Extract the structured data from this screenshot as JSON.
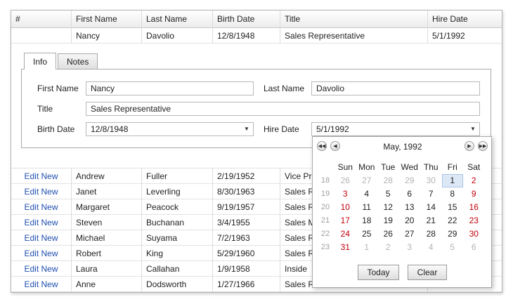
{
  "grid": {
    "columns": [
      "#",
      "First Name",
      "Last Name",
      "Birth Date",
      "Title",
      "Hire Date"
    ],
    "expanded_row": {
      "first": "Nancy",
      "last": "Davolio",
      "birth": "12/8/1948",
      "title": "Sales Representative",
      "hire": "5/1/1992"
    },
    "edit_label": "Edit New",
    "rows": [
      {
        "first": "Andrew",
        "last": "Fuller",
        "birth": "2/19/1952",
        "title": "Vice Pr"
      },
      {
        "first": "Janet",
        "last": "Leverling",
        "birth": "8/30/1963",
        "title": "Sales R"
      },
      {
        "first": "Margaret",
        "last": "Peacock",
        "birth": "9/19/1957",
        "title": "Sales R"
      },
      {
        "first": "Steven",
        "last": "Buchanan",
        "birth": "3/4/1955",
        "title": "Sales M"
      },
      {
        "first": "Michael",
        "last": "Suyama",
        "birth": "7/2/1963",
        "title": "Sales R"
      },
      {
        "first": "Robert",
        "last": "King",
        "birth": "5/29/1960",
        "title": "Sales R"
      },
      {
        "first": "Laura",
        "last": "Callahan",
        "birth": "1/9/1958",
        "title": "Inside"
      },
      {
        "first": "Anne",
        "last": "Dodsworth",
        "birth": "1/27/1966",
        "title": "Sales R"
      }
    ]
  },
  "detail": {
    "tabs": [
      "Info",
      "Notes"
    ],
    "active_tab": "Info",
    "labels": {
      "first_name": "First Name",
      "last_name": "Last Name",
      "title": "Title",
      "birth_date": "Birth Date",
      "hire_date": "Hire Date"
    },
    "values": {
      "first_name": "Nancy",
      "last_name": "Davolio",
      "title": "Sales Representative",
      "birth_date": "12/8/1948",
      "hire_date": "5/1/1992"
    }
  },
  "calendar": {
    "month_title": "May, 1992",
    "weekdays": [
      "Sun",
      "Mon",
      "Tue",
      "Wed",
      "Thu",
      "Fri",
      "Sat"
    ],
    "weeks": [
      {
        "num": "18",
        "days": [
          "26",
          "27",
          "28",
          "29",
          "30",
          "1",
          "2"
        ]
      },
      {
        "num": "19",
        "days": [
          "3",
          "4",
          "5",
          "6",
          "7",
          "8",
          "9"
        ]
      },
      {
        "num": "20",
        "days": [
          "10",
          "11",
          "12",
          "13",
          "14",
          "15",
          "16"
        ]
      },
      {
        "num": "21",
        "days": [
          "17",
          "18",
          "19",
          "20",
          "21",
          "22",
          "23"
        ]
      },
      {
        "num": "22",
        "days": [
          "24",
          "25",
          "26",
          "27",
          "28",
          "29",
          "30"
        ]
      },
      {
        "num": "23",
        "days": [
          "31",
          "1",
          "2",
          "3",
          "4",
          "5",
          "6"
        ]
      }
    ],
    "selected_day": "1",
    "today_label": "Today",
    "clear_label": "Clear",
    "nav_icons": [
      "prev-year-icon",
      "prev-month-icon",
      "next-month-icon",
      "next-year-icon"
    ],
    "colors": {
      "weekend": "#c0000a",
      "other_month": "#b4b4b4",
      "selected_bg": "#dce8f6",
      "link": "#1f4fb0"
    }
  }
}
